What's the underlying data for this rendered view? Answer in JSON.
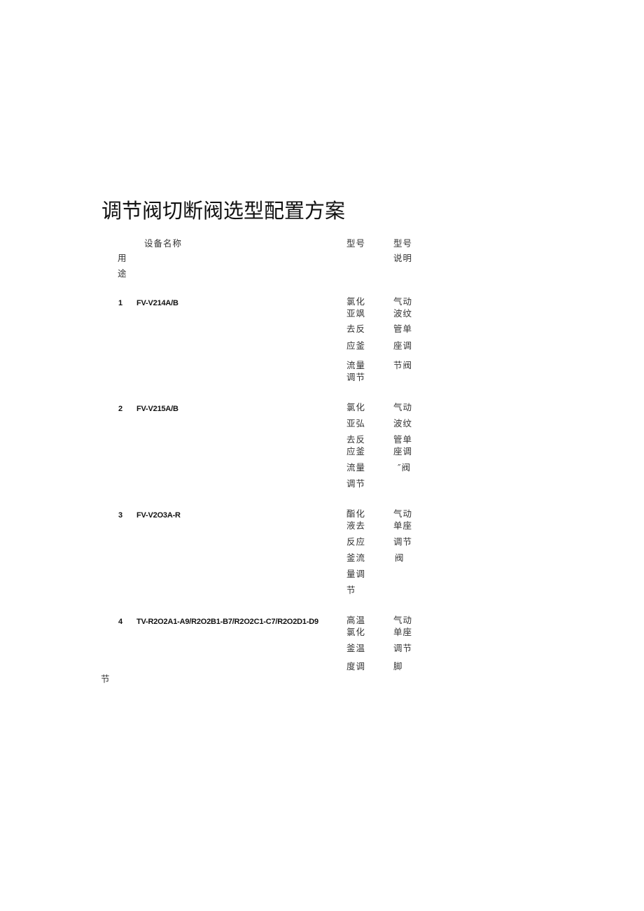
{
  "document": {
    "title": "调节阀切断阀选型配置方案",
    "header": {
      "name_col": "设备名称",
      "usage_col": [
        "用",
        "途"
      ],
      "model_col": "型号",
      "desc_col": [
        "型号",
        "说明"
      ]
    },
    "rows": [
      {
        "index": "1",
        "tag": "FV-V214A/B",
        "usage_lines": [
          "氯化",
          "亚飒",
          "去反",
          "应釜",
          "流量",
          "调节"
        ],
        "desc_lines": [
          "气动",
          "波纹",
          "管单",
          "座调",
          "节阀"
        ]
      },
      {
        "index": "2",
        "tag": "FV-V215A/B",
        "usage_lines": [
          "氯化",
          "亚弘",
          "去反",
          "应釜",
          "流量",
          "调节"
        ],
        "desc_lines": [
          "气动",
          "波纹",
          "管单",
          "座调",
          "″阀"
        ]
      },
      {
        "index": "3",
        "tag": "FV-V2O3A-R",
        "usage_lines": [
          "酯化",
          "液去",
          "反应",
          "釜流",
          "量调",
          "节"
        ],
        "desc_lines": [
          "气动",
          "单座",
          "调节",
          "阀"
        ]
      },
      {
        "index": "4",
        "tag": "TV-R2O2A1-A9/R2O2B1-B7/R2O2C1-C7/R2O2D1-D9",
        "usage_lines": [
          "高温",
          "氯化",
          "釜温",
          "度调"
        ],
        "desc_lines": [
          "气动",
          "单座",
          "调节",
          "脚"
        ],
        "overflow_text": "节"
      }
    ]
  }
}
